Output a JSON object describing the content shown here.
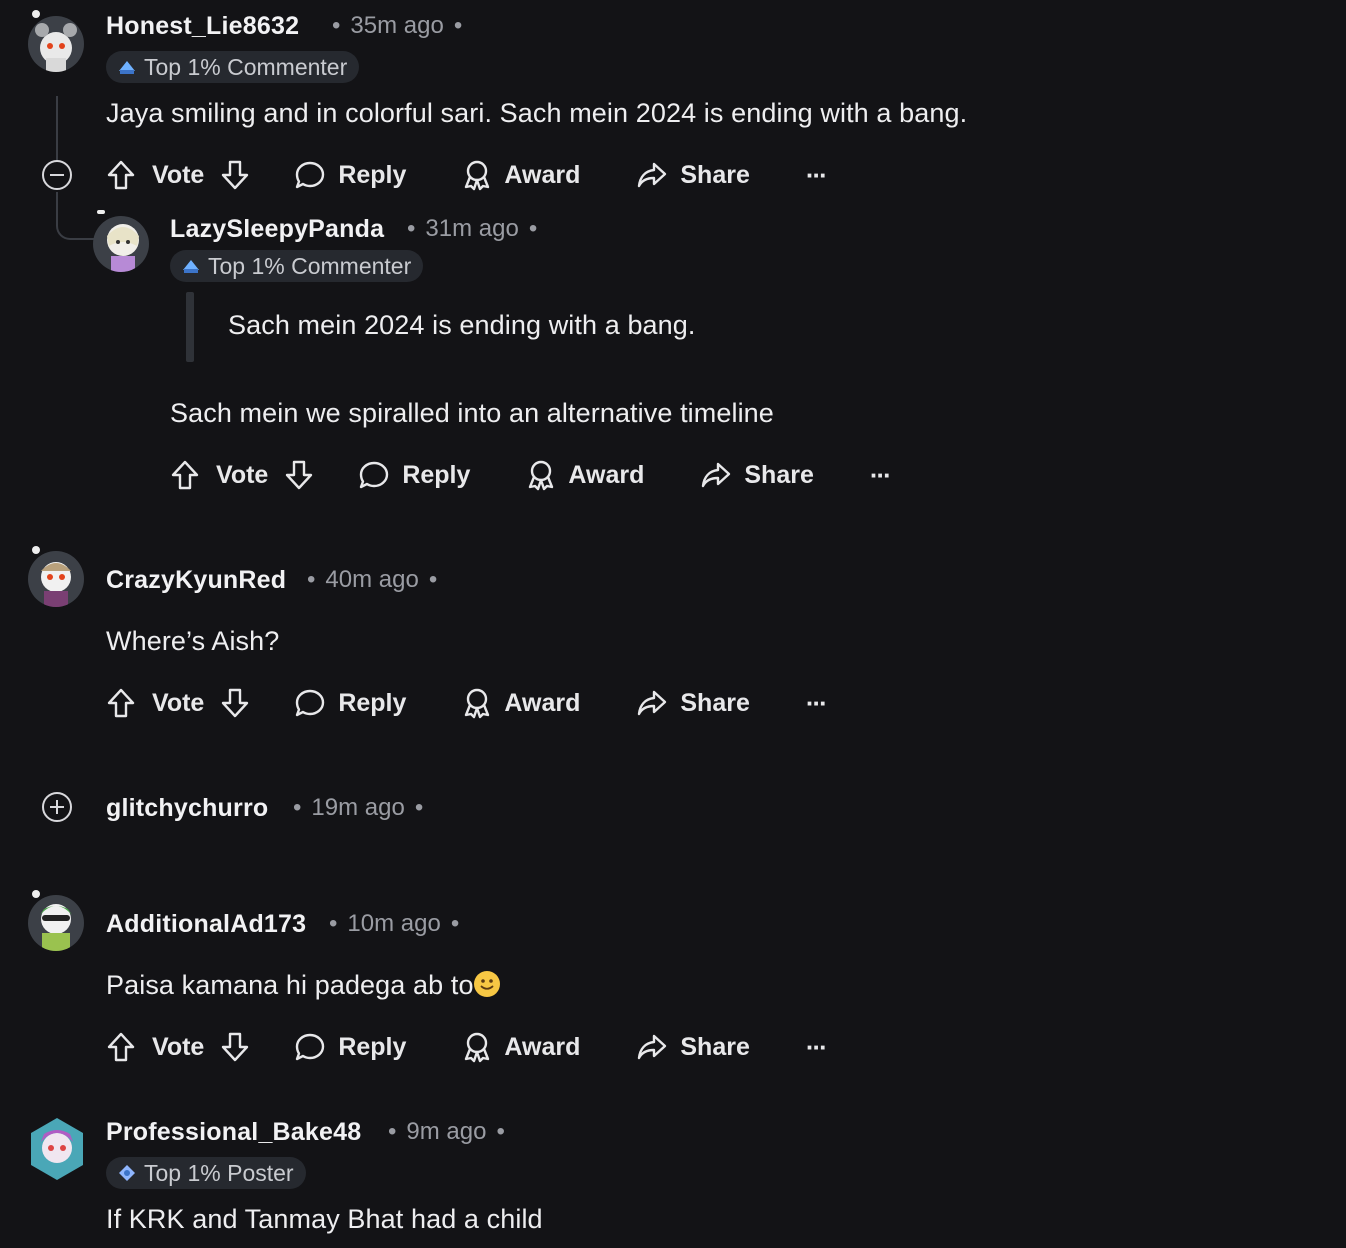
{
  "comments": [
    {
      "username": "Honest_Lie8632",
      "time": "35m ago",
      "flair": "Top 1% Commenter",
      "body": "Jaya smiling and in colorful sari. Sach mein 2024 is ending with a bang."
    },
    {
      "username": "LazySleepyPanda",
      "time": "31m ago",
      "flair": "Top 1% Commenter",
      "quote": "Sach mein 2024 is ending with a bang.",
      "body": "Sach mein we spiralled into an alternative timeline"
    },
    {
      "username": "CrazyKyunRed",
      "time": "40m ago",
      "body": "Where’s Aish?"
    },
    {
      "username": "glitchychurro",
      "time": "19m ago"
    },
    {
      "username": "AdditionalAd173",
      "time": "10m ago",
      "body": "Paisa kamana hi padega ab to"
    },
    {
      "username": "Professional_Bake48",
      "time": "9m ago",
      "flair": "Top 1% Poster",
      "body": "If KRK and Tanmay Bhat had a child"
    }
  ],
  "actions": {
    "vote": "Vote",
    "reply": "Reply",
    "award": "Award",
    "share": "Share",
    "more": "···"
  },
  "separator": "•",
  "icons": {
    "upvote": "upvote-arrow-icon",
    "downvote": "downvote-arrow-icon",
    "reply": "speech-bubble-icon",
    "award": "award-ribbon-icon",
    "share": "share-arrow-icon",
    "more": "ellipsis-icon",
    "collapse": "minus-circle-icon",
    "expand": "plus-circle-icon"
  }
}
